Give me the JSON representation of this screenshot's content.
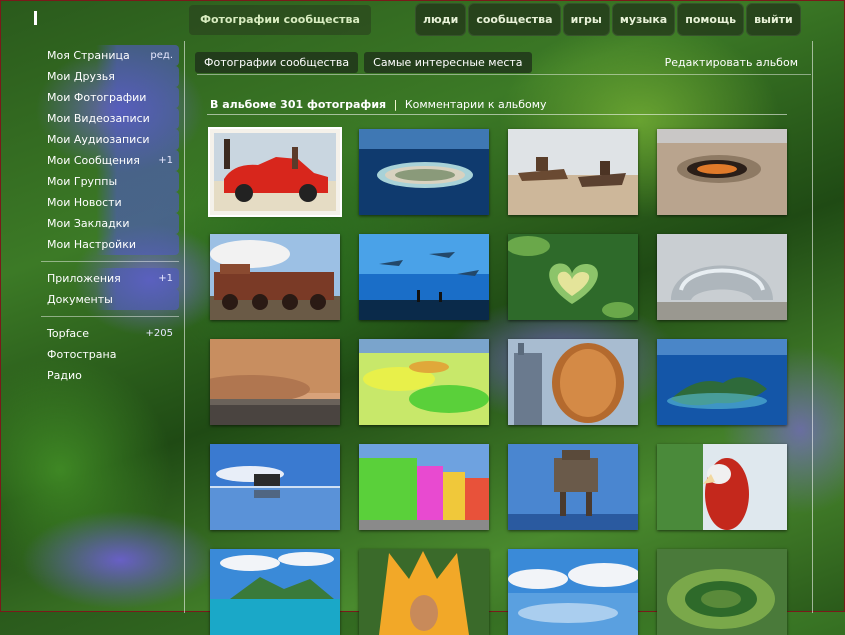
{
  "header": {
    "title": "Фотографии сообщества",
    "nav": [
      "люди",
      "сообщества",
      "игры",
      "музыка",
      "помощь",
      "выйти"
    ]
  },
  "sidebar": {
    "items": [
      {
        "label": "Моя Страница",
        "aside": "ред."
      },
      {
        "label": "Мои Друзья"
      },
      {
        "label": "Мои Фотографии"
      },
      {
        "label": "Мои Видеозаписи"
      },
      {
        "label": "Мои Аудиозаписи"
      },
      {
        "label": "Мои Сообщения",
        "aside": "+1"
      },
      {
        "label": "Мои Группы"
      },
      {
        "label": "Мои Новости"
      },
      {
        "label": "Мои Закладки"
      },
      {
        "label": "Мои Настройки"
      }
    ],
    "apps": [
      {
        "label": "Приложения",
        "aside": "+1"
      },
      {
        "label": "Документы"
      }
    ],
    "extra": [
      {
        "label": "Topface",
        "aside": "+205"
      },
      {
        "label": "Фотострана"
      },
      {
        "label": "Радио"
      }
    ]
  },
  "tabs": [
    "Фотографии сообщества",
    "Самые интересные места"
  ],
  "edit_album": "Редактировать альбом",
  "summary": {
    "count_text": "В альбоме 301 фотография",
    "separator": "|",
    "comments_link": "Комментарии к альбому"
  },
  "photos": [
    {
      "subject": "red vintage car on beach"
    },
    {
      "subject": "atoll island aerial"
    },
    {
      "subject": "abandoned ships in desert"
    },
    {
      "subject": "crater in desert"
    },
    {
      "subject": "old steam locomotive"
    },
    {
      "subject": "aquarium tunnel with sharks"
    },
    {
      "subject": "heart-shaped island"
    },
    {
      "subject": "cloud gate bean sculpture"
    },
    {
      "subject": "dust storm"
    },
    {
      "subject": "colorful salt flats"
    },
    {
      "subject": "city towers"
    },
    {
      "subject": "rocky island in blue sea"
    },
    {
      "subject": "car on mirror salt flat"
    },
    {
      "subject": "colorful houses"
    },
    {
      "subject": "sea fort on stilts"
    },
    {
      "subject": "red parrot"
    },
    {
      "subject": "island with mountains"
    },
    {
      "subject": "carnival costume"
    },
    {
      "subject": "clouds over water"
    },
    {
      "subject": "green volcanic crater"
    }
  ]
}
